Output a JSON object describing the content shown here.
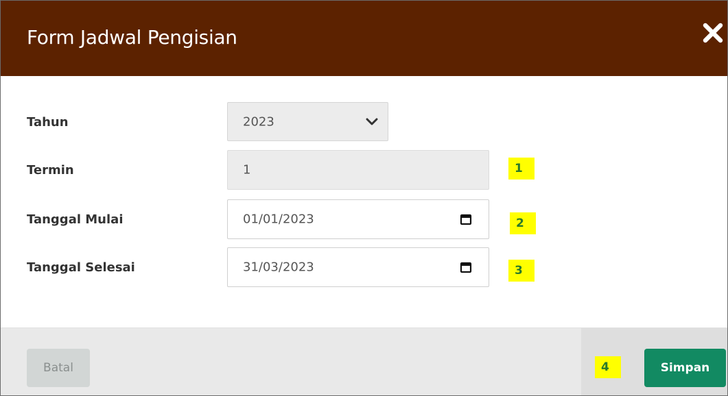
{
  "modal": {
    "title": "Form Jadwal Pengisian",
    "header_color": "#5c2200",
    "close_icon": "close-icon"
  },
  "form": {
    "tahun": {
      "label": "Tahun",
      "value": "2023",
      "icon": "chevron-down-icon"
    },
    "termin": {
      "label": "Termin",
      "value": "1"
    },
    "tanggal_mulai": {
      "label": "Tanggal Mulai",
      "value": "01/01/2023",
      "icon": "calendar-icon"
    },
    "tanggal_selesai": {
      "label": "Tanggal Selesai",
      "value": "31/03/2023",
      "icon": "calendar-icon"
    }
  },
  "markers": [
    "1",
    "2",
    "3",
    "4"
  ],
  "footer": {
    "cancel_label": "Batal",
    "save_label": "Simpan",
    "save_color": "#128a62"
  }
}
